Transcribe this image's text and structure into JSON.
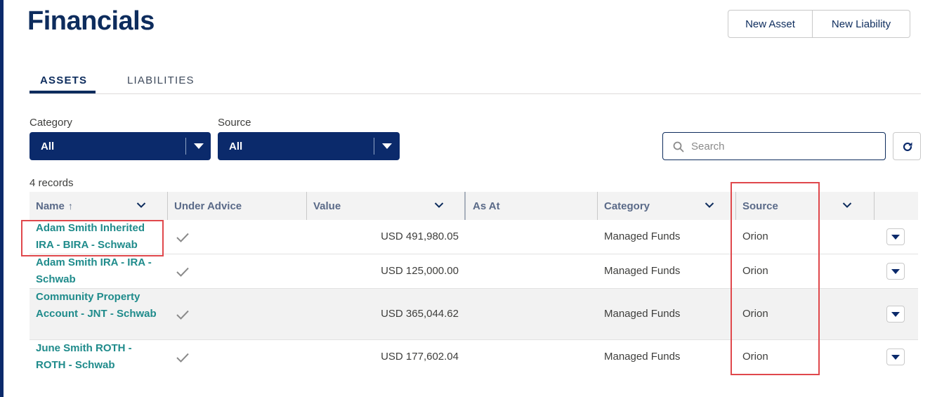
{
  "header": {
    "title": "Financials",
    "buttons": {
      "new_asset": "New Asset",
      "new_liability": "New Liability"
    }
  },
  "tabs": [
    {
      "label": "ASSETS",
      "active": true
    },
    {
      "label": "LIABILITIES",
      "active": false
    }
  ],
  "filters": {
    "category": {
      "label": "Category",
      "value": "All"
    },
    "source": {
      "label": "Source",
      "value": "All"
    }
  },
  "search": {
    "placeholder": "Search",
    "value": ""
  },
  "table": {
    "record_count": "4 records",
    "columns": {
      "name": "Name",
      "under_advice": "Under Advice",
      "value": "Value",
      "as_at": "As At",
      "category": "Category",
      "source": "Source"
    },
    "sort": {
      "column": "name",
      "direction": "ascending"
    },
    "rows": [
      {
        "name": "Adam Smith Inherited IRA - BIRA - Schwab",
        "under_advice": true,
        "value": "USD 491,980.05",
        "as_at": "",
        "category": "Managed Funds",
        "source": "Orion"
      },
      {
        "name": "Adam Smith IRA - IRA - Schwab",
        "under_advice": true,
        "value": "USD 125,000.00",
        "as_at": "",
        "category": "Managed Funds",
        "source": "Orion"
      },
      {
        "name": "Community Property Account - JNT - Schwab",
        "under_advice": true,
        "value": "USD 365,044.62",
        "as_at": "",
        "category": "Managed Funds",
        "source": "Orion"
      },
      {
        "name": "June Smith ROTH - ROTH - Schwab",
        "under_advice": true,
        "value": "USD 177,602.04",
        "as_at": "",
        "category": "Managed Funds",
        "source": "Orion"
      }
    ]
  },
  "colors": {
    "brand_navy": "#0b2a6b",
    "link_teal": "#1f8b8b",
    "highlight_red": "#e0484c"
  },
  "icons": {
    "search": "search-icon",
    "refresh": "refresh-icon",
    "check": "check-icon",
    "sort": "arrow-up-icon",
    "column_menu": "chevron-down-icon",
    "row_menu": "caret-down-icon"
  }
}
